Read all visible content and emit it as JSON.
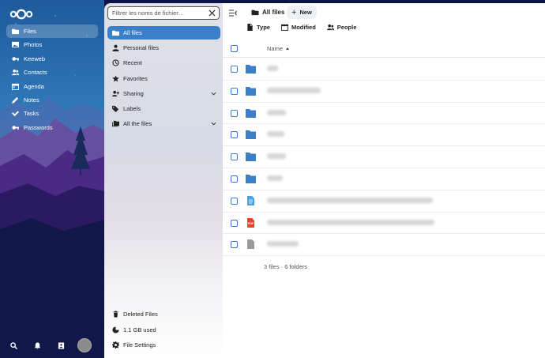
{
  "rail": {
    "apps": [
      {
        "label": "Files",
        "icon": "folder-icon",
        "active": true
      },
      {
        "label": "Photos",
        "icon": "image-icon",
        "active": false
      },
      {
        "label": "Keeweb",
        "icon": "key-icon",
        "active": false
      },
      {
        "label": "Contacts",
        "icon": "contacts-icon",
        "active": false
      },
      {
        "label": "Agenda",
        "icon": "calendar-icon",
        "active": false
      },
      {
        "label": "Notes",
        "icon": "pencil-icon",
        "active": false
      },
      {
        "label": "Tasks",
        "icon": "check-icon",
        "active": false
      },
      {
        "label": "Passwords",
        "icon": "key-icon",
        "active": false
      }
    ]
  },
  "nav": {
    "search_placeholder": "Filtrer les noms de fichier…",
    "items": [
      {
        "label": "All files",
        "icon": "folder-icon",
        "active": true
      },
      {
        "label": "Personal files",
        "icon": "account-icon"
      },
      {
        "label": "Recent",
        "icon": "history-icon"
      },
      {
        "label": "Favorites",
        "icon": "star-icon"
      },
      {
        "label": "Sharing",
        "icon": "share-icon",
        "expandable": true
      },
      {
        "label": "Labels",
        "icon": "tag-icon"
      },
      {
        "label": "All the files",
        "icon": "folder-multiple-icon",
        "expandable": true
      }
    ],
    "footer": [
      {
        "label": "Deleted Files",
        "icon": "trash-icon"
      },
      {
        "label": "1.1 GB used",
        "icon": "pie-chart-icon"
      },
      {
        "label": "File Settings",
        "icon": "gear-icon"
      }
    ]
  },
  "main": {
    "breadcrumb": "All files",
    "new_label": "New",
    "filters": [
      "Type",
      "Modified",
      "People"
    ],
    "column_name": "Name",
    "rows": [
      {
        "kind": "folder"
      },
      {
        "kind": "folder"
      },
      {
        "kind": "folder"
      },
      {
        "kind": "folder"
      },
      {
        "kind": "folder"
      },
      {
        "kind": "folder"
      },
      {
        "kind": "document"
      },
      {
        "kind": "pdf"
      },
      {
        "kind": "file"
      }
    ],
    "summary": "3 files · 6 folders"
  },
  "colors": {
    "accent": "#3a7fc8",
    "folder": "#3a7fc8",
    "pdf": "#e1462f",
    "doc": "#4aa3df"
  }
}
